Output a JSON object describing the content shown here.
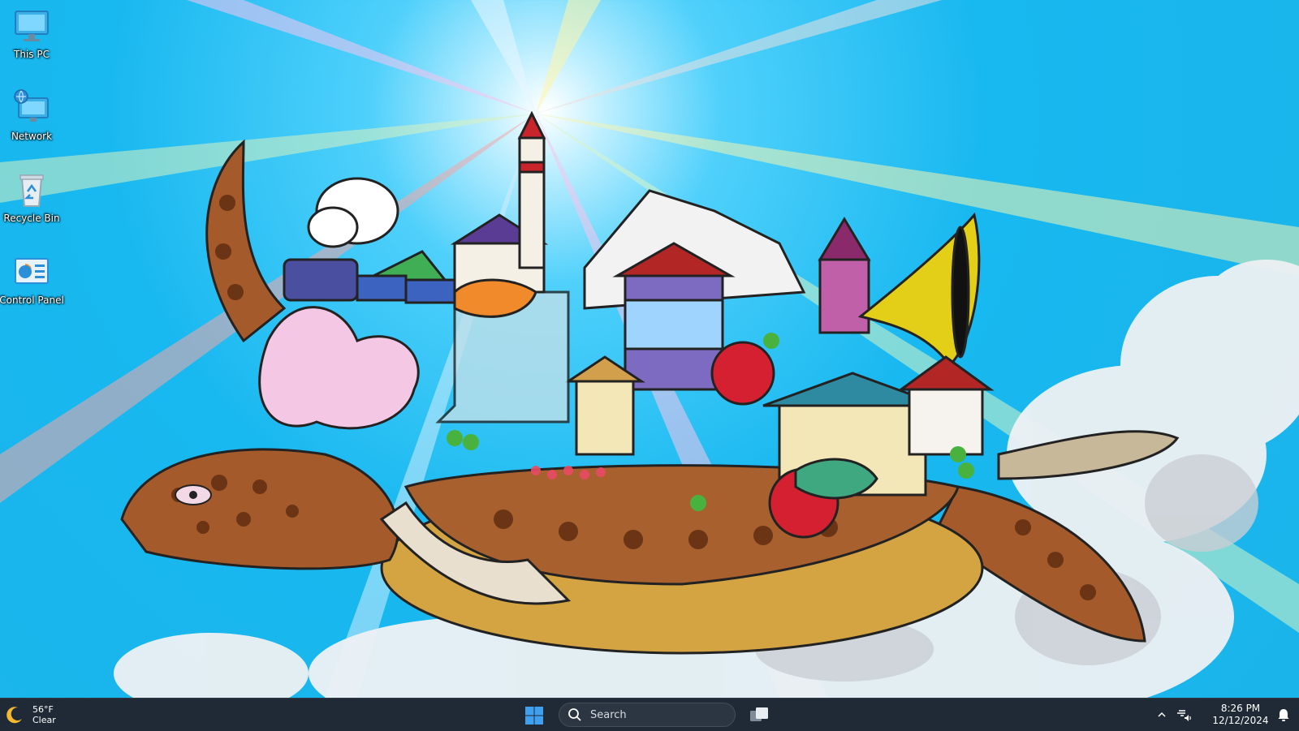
{
  "desktop": {
    "icons": [
      {
        "label": "This PC",
        "icon": "computer-icon"
      },
      {
        "label": "Network",
        "icon": "network-icon"
      },
      {
        "label": "Recycle Bin",
        "icon": "recycle-bin-icon"
      },
      {
        "label": "Control Panel",
        "icon": "control-panel-icon"
      }
    ],
    "wallpaper": "flying-turtle-city-illustration"
  },
  "taskbar": {
    "weather": {
      "temp": "56°F",
      "condition": "Clear",
      "icon": "moon-icon"
    },
    "start_icon": "windows-logo-icon",
    "search": {
      "placeholder": "Search",
      "icon": "search-icon"
    },
    "taskview_icon": "task-view-icon",
    "tray": {
      "chevron_icon": "chevron-up-icon",
      "network_icon": "network-volume-icon",
      "time": "8:26 PM",
      "date": "12/12/2024",
      "notification_icon": "bell-icon"
    }
  },
  "colors": {
    "sky": "#18b8f0",
    "taskbar": "#1f2a36",
    "windows_blue": "#3fa0f0"
  }
}
